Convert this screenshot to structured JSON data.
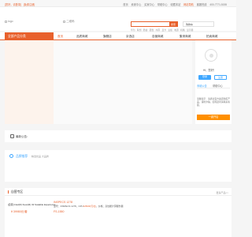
{
  "topbar": {
    "login_label": "[您好，请登录]",
    "register_label": "[免费注册]",
    "links": [
      "首页",
      "卖家中心",
      "买家中心",
      "帮助中心",
      "收藏本站",
      "网站导航",
      "客服热线",
      "400-7771-5155"
    ],
    "hot_index": 5
  },
  "header": {
    "logo_alt": "logo",
    "qr_alt": "二维码",
    "search_button": "搜索",
    "cart_label": "购物车",
    "hotwords": [
      "华为",
      "联想",
      "酷睿",
      "硬盘",
      "内存",
      "显卡",
      "主板",
      "电源",
      "机箱",
      "显示器"
    ]
  },
  "nav": {
    "category_label": "全部产品分类",
    "items": [
      "首页",
      "品质商城",
      "旗舰店",
      "京选店",
      "自营商城",
      "集采商城",
      "拍卖商城"
    ],
    "active_index": 0
  },
  "user_panel": {
    "greeting": "Hi，您好！",
    "login_button": "登录",
    "register_button": "注册",
    "tabs": [
      "商城公告",
      "帮助中心"
    ],
    "notice": "温馨提示：请通过官方渠道购买产品，谨防诈骗，如有疑问请联系客服。",
    "shop_button": "一键开店"
  },
  "announcement": {
    "text": "最新公告："
  },
  "brand": {
    "title": "品牌推荐",
    "subtitle": "精选优品  大品牌"
  },
  "featured": {
    "title": "自营专区",
    "more": "更多产品>>",
    "products": [
      {
        "name": "[自营] Intel(R) Xeon(R) 32 Scalable Experience...",
        "price": "¥ 39980元/套"
      },
      {
        "model": "INSPECS 1278",
        "desc_prefix": "型号：INSPECS 1278，CPU",
        "price": "¥25000元/台",
        "desc_suffix": "，价格：高性能计算服务器",
        "model2": "FS-1550"
      }
    ]
  },
  "colors": {
    "accent": "#e8612c",
    "blue": "#3fa7ff",
    "orange_button": "#ff8f00"
  }
}
